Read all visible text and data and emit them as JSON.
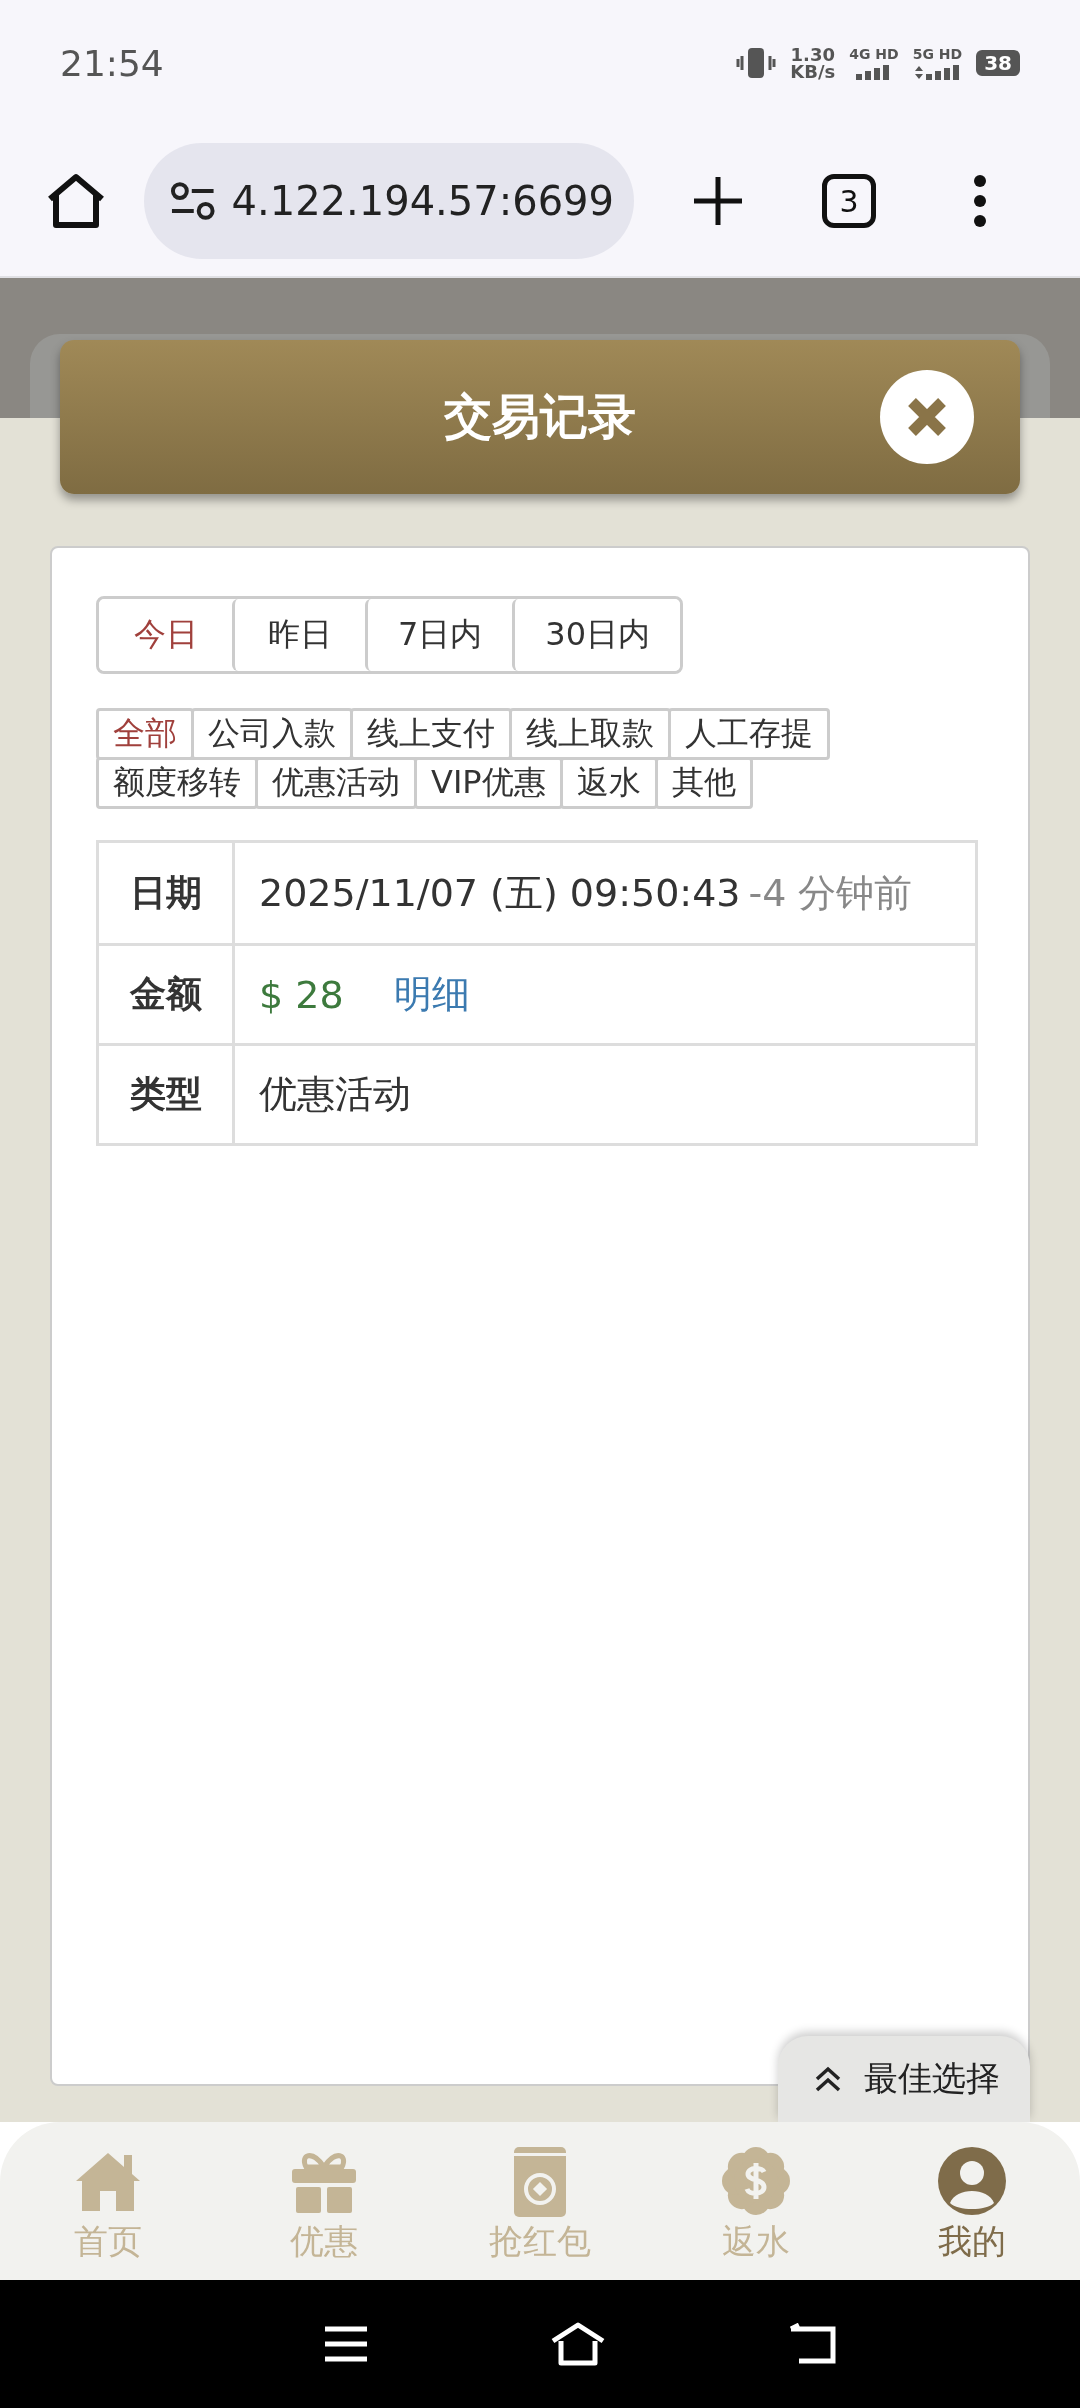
{
  "status_bar": {
    "time": "21:54",
    "speed": "1.30",
    "speed_unit": "KB/s",
    "sim_1": "4G HD",
    "sim_2": "5G HD",
    "battery": "38"
  },
  "browser": {
    "url": "4.122.194.57:6699",
    "tab_count": "3"
  },
  "modal": {
    "title": "交易记录"
  },
  "date_tabs": [
    {
      "label": "今日",
      "selected": true
    },
    {
      "label": "昨日",
      "selected": false
    },
    {
      "label": "7日内",
      "selected": false
    },
    {
      "label": "30日内",
      "selected": false
    }
  ],
  "type_filters": [
    {
      "label": "全部",
      "selected": true
    },
    {
      "label": "公司入款",
      "selected": false
    },
    {
      "label": "线上支付",
      "selected": false
    },
    {
      "label": "线上取款",
      "selected": false
    },
    {
      "label": "人工存提",
      "selected": false
    },
    {
      "label": "额度移转",
      "selected": false
    },
    {
      "label": "优惠活动",
      "selected": false
    },
    {
      "label": "VIP优惠",
      "selected": false
    },
    {
      "label": "返水",
      "selected": false
    },
    {
      "label": "其他",
      "selected": false
    }
  ],
  "record": [
    {
      "kind": "date",
      "label": "日期",
      "value": "2025/11/07 (五) 09:50:43",
      "note": "-4 分钟前"
    },
    {
      "kind": "amount",
      "label": "金额",
      "value": "$ 28",
      "link": "明细"
    },
    {
      "kind": "text",
      "label": "类型",
      "value": "优惠活动"
    }
  ],
  "float_button": {
    "label": "最佳选择"
  },
  "bottom_nav": [
    {
      "kind": "home",
      "label": "首页",
      "selected": false
    },
    {
      "kind": "gift",
      "label": "优惠",
      "selected": false
    },
    {
      "kind": "envelope",
      "label": "抢红包",
      "selected": false
    },
    {
      "kind": "coin",
      "label": "返水",
      "selected": false
    },
    {
      "kind": "user",
      "label": "我的",
      "selected": true
    }
  ]
}
